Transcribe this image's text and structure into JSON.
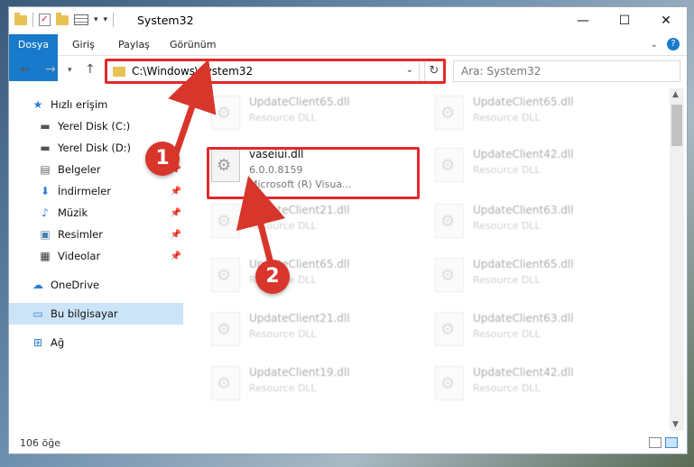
{
  "window": {
    "title": "System32"
  },
  "ribbon": {
    "tabs": [
      "Dosya",
      "Giriş",
      "Paylaş",
      "Görünüm"
    ]
  },
  "address": {
    "path": "C:\\Windows\\System32"
  },
  "search": {
    "placeholder": "Ara: System32"
  },
  "sidebar": {
    "items": [
      {
        "label": "Hızlı erişim",
        "icon": "star-icon",
        "pinned": false
      },
      {
        "label": "Yerel Disk (C:)",
        "icon": "drive-icon",
        "pinned": false
      },
      {
        "label": "Yerel Disk (D:)",
        "icon": "drive-icon",
        "pinned": false
      },
      {
        "label": "Belgeler",
        "icon": "document-icon",
        "pinned": true
      },
      {
        "label": "İndirmeler",
        "icon": "download-icon",
        "pinned": true
      },
      {
        "label": "Müzik",
        "icon": "music-icon",
        "pinned": true
      },
      {
        "label": "Resimler",
        "icon": "picture-icon",
        "pinned": true
      },
      {
        "label": "Videolar",
        "icon": "video-icon",
        "pinned": true
      },
      {
        "label": "OneDrive",
        "icon": "cloud-icon",
        "pinned": false
      },
      {
        "label": "Bu bilgisayar",
        "icon": "computer-icon",
        "pinned": false,
        "selected": true
      },
      {
        "label": "Ağ",
        "icon": "network-icon",
        "pinned": false
      }
    ]
  },
  "files": [
    {
      "name": "UpdateClient65.dll",
      "desc": "Resource DLL",
      "faded": true
    },
    {
      "name": "UpdateClient65.dll",
      "desc": "Resource DLL",
      "faded": true
    },
    {
      "name": "vaseiui.dll",
      "desc": "6.0.0.8159",
      "desc2": "Microsoft (R) Visua...",
      "faded": false
    },
    {
      "name": "UpdateClient42.dll",
      "desc": "Resource DLL",
      "faded": true
    },
    {
      "name": "UpdateClient21.dll",
      "desc": "Resource DLL",
      "faded": true
    },
    {
      "name": "UpdateClient63.dll",
      "desc": "Resource DLL",
      "faded": true
    },
    {
      "name": "UpdateClient65.dll",
      "desc": "Resource DLL",
      "faded": true
    },
    {
      "name": "UpdateClient65.dll",
      "desc": "Resource DLL",
      "faded": true
    },
    {
      "name": "UpdateClient21.dll",
      "desc": "Resource DLL",
      "faded": true
    },
    {
      "name": "UpdateClient63.dll",
      "desc": "Resource DLL",
      "faded": true
    },
    {
      "name": "UpdateClient19.dll",
      "desc": "Resource DLL",
      "faded": true
    },
    {
      "name": "UpdateClient42.dll",
      "desc": "Resource DLL",
      "faded": true
    }
  ],
  "status": {
    "count": "106 öğe"
  },
  "annotations": {
    "step1": "1",
    "step2": "2",
    "color": "#d8362b"
  }
}
